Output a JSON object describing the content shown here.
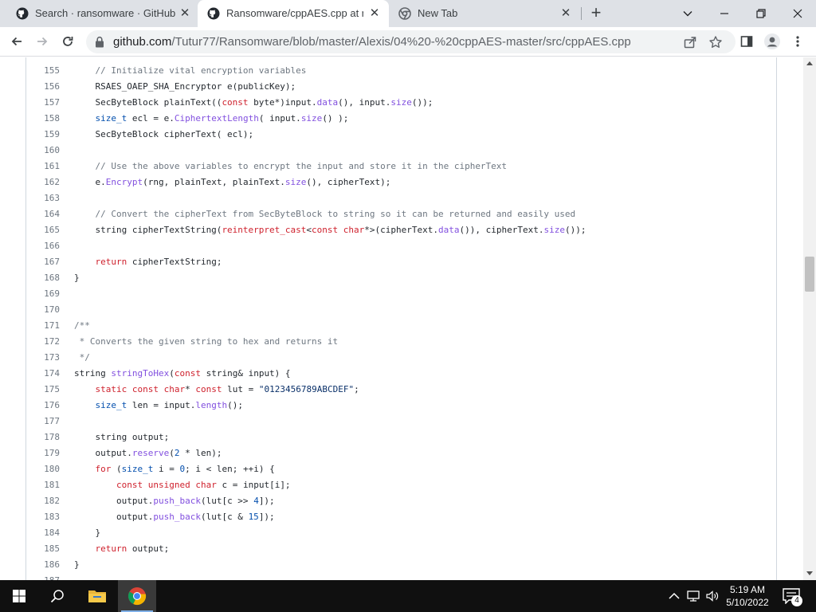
{
  "browser": {
    "tabs": [
      {
        "title": "Search · ransomware · GitHub",
        "icon": "github-icon"
      },
      {
        "title": "Ransomware/cppAES.cpp at mas",
        "icon": "github-icon",
        "active": true
      },
      {
        "title": "New Tab",
        "icon": "chrome-icon"
      }
    ],
    "url_host": "github.com",
    "url_path": "/Tutur77/Ransomware/blob/master/Alexis/04%20-%20cppAES-master/src/cppAES.cpp"
  },
  "code": {
    "lines": [
      {
        "n": "155",
        "t": "    // Initialize vital encryption variables"
      },
      {
        "n": "156",
        "t": "    RSAES_OAEP_SHA_Encryptor e(publicKey);"
      },
      {
        "n": "157",
        "t": "    SecByteBlock plainText((const byte*)input.data(), input.size());"
      },
      {
        "n": "158",
        "t": "    size_t ecl = e.CiphertextLength( input.size() );"
      },
      {
        "n": "159",
        "t": "    SecByteBlock cipherText( ecl);"
      },
      {
        "n": "160",
        "t": ""
      },
      {
        "n": "161",
        "t": "    // Use the above variables to encrypt the input and store it in the cipherText"
      },
      {
        "n": "162",
        "t": "    e.Encrypt(rng, plainText, plainText.size(), cipherText);"
      },
      {
        "n": "163",
        "t": ""
      },
      {
        "n": "164",
        "t": "    // Convert the cipherText from SecByteBlock to string so it can be returned and easily used"
      },
      {
        "n": "165",
        "t": "    string cipherTextString(reinterpret_cast<const char*>(cipherText.data()), cipherText.size());"
      },
      {
        "n": "166",
        "t": ""
      },
      {
        "n": "167",
        "t": "    return cipherTextString;"
      },
      {
        "n": "168",
        "t": "}"
      },
      {
        "n": "169",
        "t": ""
      },
      {
        "n": "170",
        "t": ""
      },
      {
        "n": "171",
        "t": "/**"
      },
      {
        "n": "172",
        "t": " * Converts the given string to hex and returns it"
      },
      {
        "n": "173",
        "t": " */"
      },
      {
        "n": "174",
        "t": "string stringToHex(const string& input) {"
      },
      {
        "n": "175",
        "t": "    static const char* const lut = \"0123456789ABCDEF\";"
      },
      {
        "n": "176",
        "t": "    size_t len = input.length();"
      },
      {
        "n": "177",
        "t": ""
      },
      {
        "n": "178",
        "t": "    string output;"
      },
      {
        "n": "179",
        "t": "    output.reserve(2 * len);"
      },
      {
        "n": "180",
        "t": "    for (size_t i = 0; i < len; ++i) {"
      },
      {
        "n": "181",
        "t": "        const unsigned char c = input[i];"
      },
      {
        "n": "182",
        "t": "        output.push_back(lut[c >> 4]);"
      },
      {
        "n": "183",
        "t": "        output.push_back(lut[c & 15]);"
      },
      {
        "n": "184",
        "t": "    }"
      },
      {
        "n": "185",
        "t": "    return output;"
      },
      {
        "n": "186",
        "t": "}"
      },
      {
        "n": "187",
        "t": ""
      }
    ]
  },
  "taskbar": {
    "time": "5:19 AM",
    "date": "5/10/2022",
    "notification_count": "4"
  },
  "colors": {
    "comment": "#6e7781",
    "keyword": "#cf222e",
    "function": "#8250df",
    "string": "#0a3069",
    "type": "#0550ae"
  }
}
